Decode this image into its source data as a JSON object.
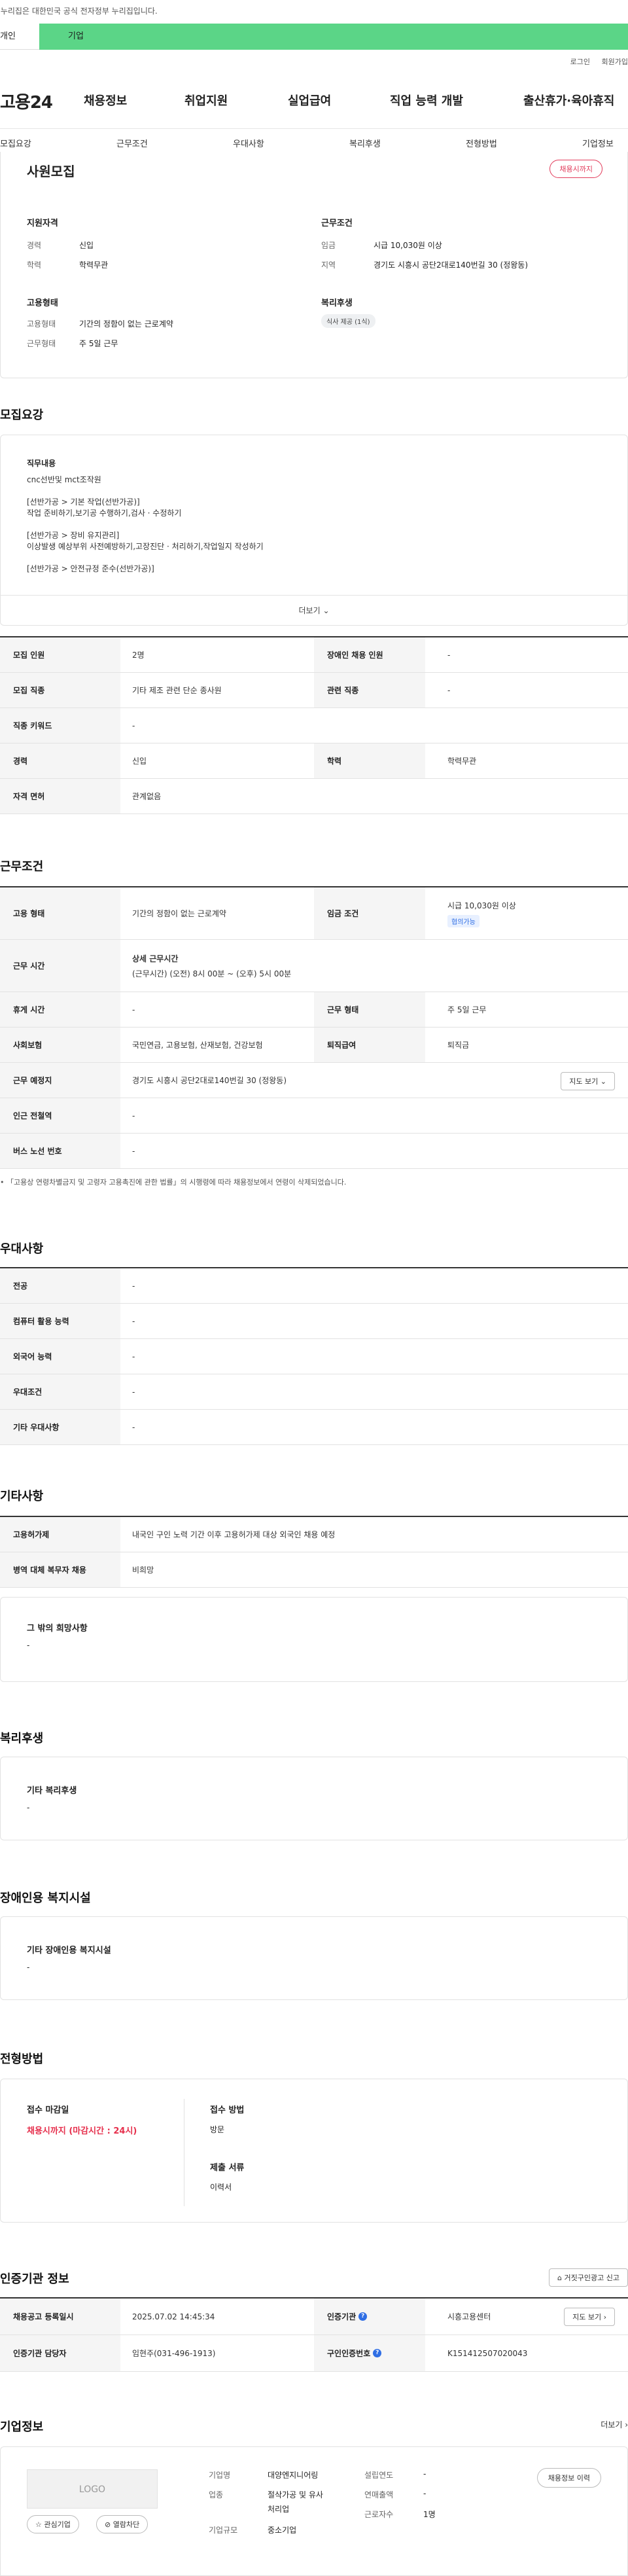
{
  "gov_banner": "이 누리집은 대한민국 공식 전자정부 누리집입니다.",
  "top_tabs": {
    "personal": "개인",
    "company": "기업"
  },
  "util": {
    "login": "로그인",
    "signup": "회원가입"
  },
  "logo": "고용24",
  "gnb": [
    "채용정보",
    "취업지원",
    "실업급여",
    "직업 능력 개발",
    "출산휴가·육아휴직"
  ],
  "subnav": [
    "모집요강",
    "근무조건",
    "우대사항",
    "복리후생",
    "전형방법",
    "기업정보"
  ],
  "summary": {
    "title": "사원모집",
    "status_pill": "채용시까지",
    "qual_title": "지원자격",
    "career_label": "경력",
    "career_value": "신입",
    "edu_label": "학력",
    "edu_value": "학력무관",
    "emp_title": "고용형태",
    "emp_label": "고용형태",
    "emp_value": "기간의 정함이 없는 근로계약",
    "worktype_label": "근무형태",
    "worktype_value": "주 5일 근무",
    "cond_title": "근무조건",
    "wage_label": "임금",
    "wage_value": "시급 10,030원 이상",
    "region_label": "지역",
    "region_value": "경기도 시흥시 공단2대로140번길 30 (정왕동)",
    "welfare_title": "복리후생",
    "welfare_badge": "식사 제공 (1식)"
  },
  "recruit": {
    "heading": "모집요강",
    "job_title": "직무내용",
    "job_lines": [
      "cnc선반및 mct조작원",
      "",
      "[선반가공 > 기본 작업(선반가공)]",
      "작업 준비하기,보기공 수행하기,검사 · 수정하기",
      "",
      "[선반가공 > 장비 유지관리]",
      "이상발생 예상부위 사전예방하기,고장진단 · 처리하기,작업일지 작성하기",
      "",
      "[선반가공 > 안전규정 준수(선반가공)]"
    ],
    "more": "더보기",
    "rows": [
      {
        "k1": "모집 인원",
        "v1": "2명",
        "k2": "장애인 채용 인원",
        "v2": "-"
      },
      {
        "k1": "모집 직종",
        "v1": "기타 제조 관련 단순 종사원",
        "k2": "관련 직종",
        "v2": "-"
      },
      {
        "k1": "직종 키워드",
        "v1": "-"
      },
      {
        "k1": "경력",
        "v1": "신입",
        "k2": "학력",
        "v2": "학력무관"
      },
      {
        "k1": "자격 면허",
        "v1": "관계없음"
      }
    ]
  },
  "work": {
    "heading": "근무조건",
    "emp_label": "고용 형태",
    "emp_value": "기간의 정함이 없는 근로계약",
    "wage_label": "임금 조건",
    "wage_value": "시급 10,030원 이상",
    "wage_badge": "협의가능",
    "hours_label": "근무 시간",
    "hours_title": "상세 근무시간",
    "hours_value": "(근무시간) (오전) 8시 00분 ~ (오후) 5시 00분",
    "holiday_label": "휴게 시간",
    "holiday_value": "-",
    "form_label": "근무 형태",
    "form_value": "주 5일 근무",
    "ins_label": "사회보험",
    "ins_value": "국민연금, 고용보험, 산재보험, 건강보험",
    "sev_label": "퇴직급여",
    "sev_value": "퇴직금",
    "place_label": "근무 예정지",
    "place_value": "경기도 시흥시 공단2대로140번길 30 (정왕동)",
    "map_btn": "지도 보기",
    "station_label": "인근 전철역",
    "station_value": "-",
    "bus_label": "버스 노선 번호",
    "bus_value": "-",
    "note": "「고용상 연령차별금지 및 고령자 고용촉진에 관한 법률」의 시행령에 따라 채용정보에서 연령이 삭제되었습니다."
  },
  "pref": {
    "heading": "우대사항",
    "rows": [
      {
        "k": "전공",
        "v": "-"
      },
      {
        "k": "컴퓨터 활용 능력",
        "v": "-"
      },
      {
        "k": "외국어 능력",
        "v": "-"
      },
      {
        "k": "우대조건",
        "v": "-"
      },
      {
        "k": "기타 우대사항",
        "v": "-"
      }
    ]
  },
  "etc": {
    "heading": "기타사항",
    "rows": [
      {
        "k": "고용허가제",
        "v": "내국인 구인 노력 기간 이후 고용허가제 대상 외국인 채용 예정"
      },
      {
        "k": "병역 대체 복무자 채용",
        "v": "비희망"
      }
    ],
    "other_title": "그 밖의 희망사항",
    "other_value": "-"
  },
  "welfare": {
    "heading": "복리후생",
    "title": "기타 복리후생",
    "value": "-"
  },
  "disability": {
    "heading": "장애인용 복지시설",
    "title": "기타 장애인용 복지시설",
    "value": "-"
  },
  "selection": {
    "heading": "전형방법",
    "deadline_title": "접수 마감일",
    "deadline_value": "채용시까지 (마감시간 : 24시)",
    "method_title": "접수 방법",
    "method_value": "방문",
    "docs_title": "제출 서류",
    "docs_value": "이력서"
  },
  "agency": {
    "heading": "인증기관 정보",
    "report_btn": "거짓구인광고 신고",
    "reg_label": "채용공고 등록일시",
    "reg_value": "2025.07.02 14:45:34",
    "org_label": "인증기관",
    "org_value": "시흥고용센터",
    "map_btn": "지도 보기",
    "mgr_label": "인증기관 담당자",
    "mgr_value": "임현주(031-496-1913)",
    "no_label": "구인인증번호",
    "no_value": "K151412507020043"
  },
  "company": {
    "heading": "기업정보",
    "more": "더보기",
    "logo_text": "LOGO",
    "fav_btn": "관심기업",
    "block_btn": "열람차단",
    "name_label": "기업명",
    "name_value": "대양엔지니어링",
    "biz_label": "업종",
    "biz_value_1": "절삭가공 및 유사",
    "biz_value_2": "처리업",
    "size_label": "기업규모",
    "size_value": "중소기업",
    "est_label": "설립연도",
    "est_value": "-",
    "sales_label": "연매출액",
    "sales_value": "-",
    "emp_label": "근로자수",
    "emp_value": "1명",
    "history_btn": "채용정보 이력"
  }
}
